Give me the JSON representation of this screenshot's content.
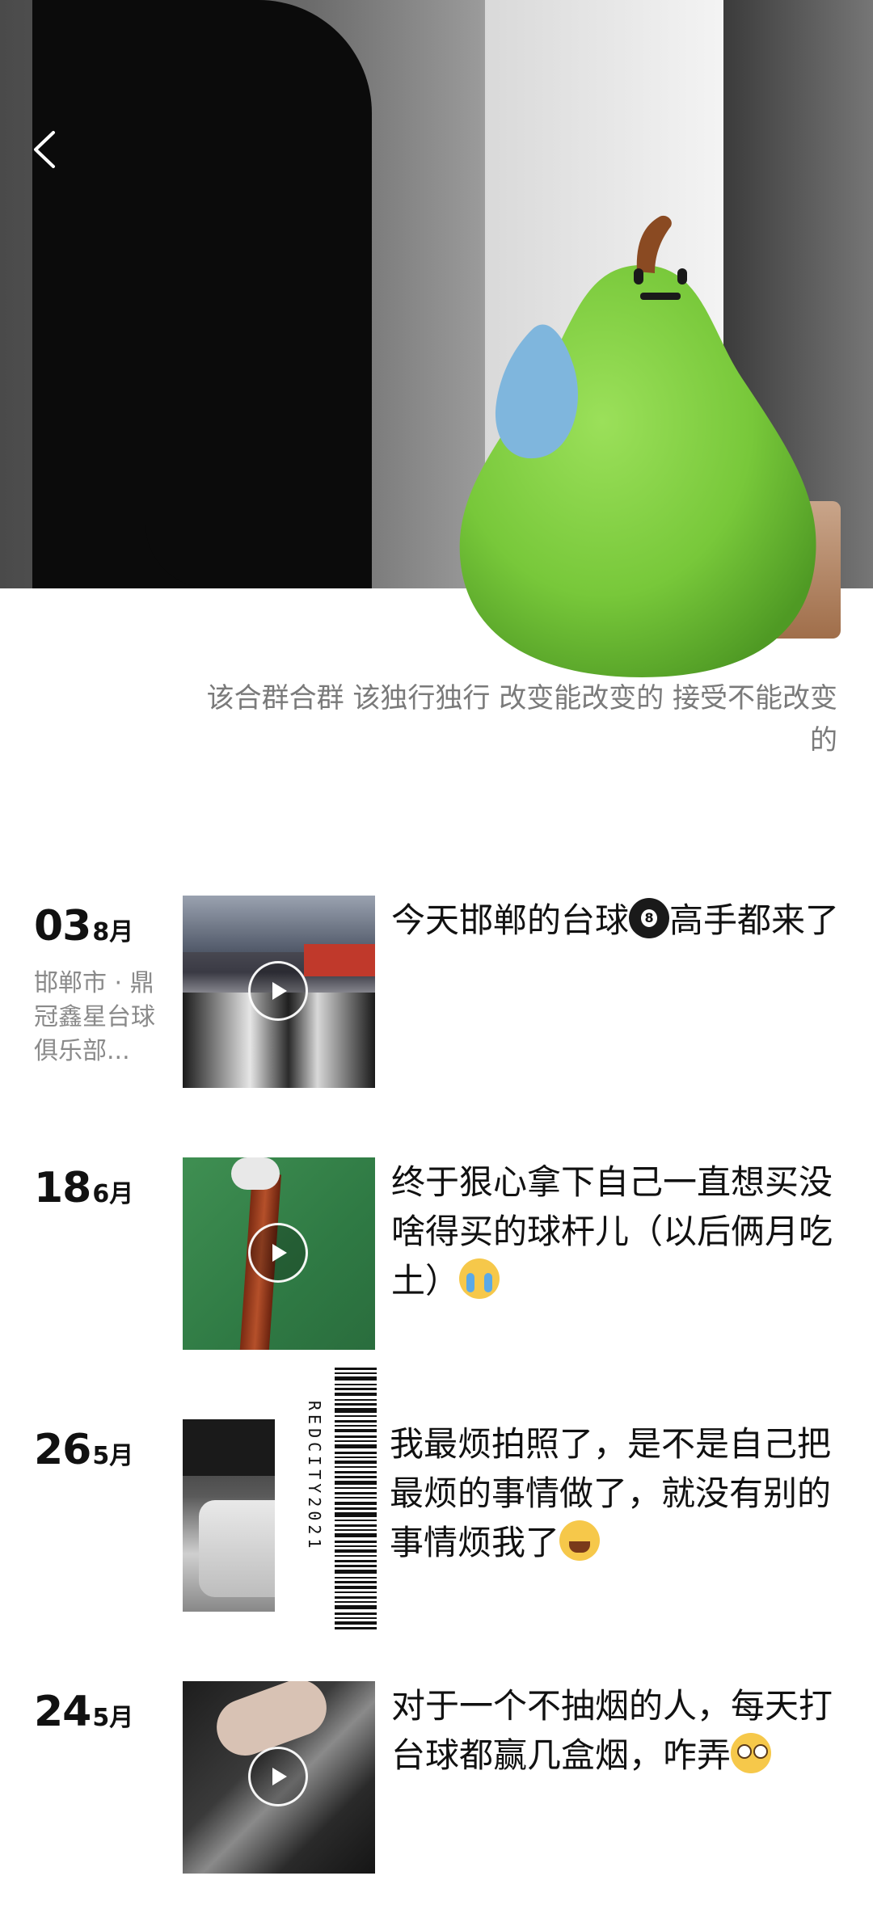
{
  "header": {
    "back_icon": "chevron-left-icon"
  },
  "profile": {
    "bio": "该合群合群 该独行独行 改变能改变的 接受不能改变的"
  },
  "posts": [
    {
      "day": "03",
      "month": "8月",
      "location": "邯郸市 · 鼎冠鑫星台球俱乐部...",
      "text_a": "今天邯郸的台球",
      "emoji": "8-ball",
      "text_b": "高手都来了",
      "has_video": true
    },
    {
      "day": "18",
      "month": "6月",
      "location": "",
      "text_a": "终于狠心拿下自己一直想买没啥得买的球杆儿（以后俩月吃土）",
      "emoji": "crying-face",
      "text_b": "",
      "has_video": true
    },
    {
      "day": "26",
      "month": "5月",
      "location": "",
      "text_a": "我最烦拍照了，是不是自己把最烦的事情做了，就没有别的事情烦我了",
      "emoji": "tired-face",
      "text_b": "",
      "has_video": false,
      "barcode_text": "REDCITY2021"
    },
    {
      "day": "24",
      "month": "5月",
      "location": "",
      "text_a": "对于一个不抽烟的人，每天打台球都赢几盒烟，咋弄",
      "emoji": "flushed-face",
      "text_b": "",
      "has_video": true
    }
  ]
}
